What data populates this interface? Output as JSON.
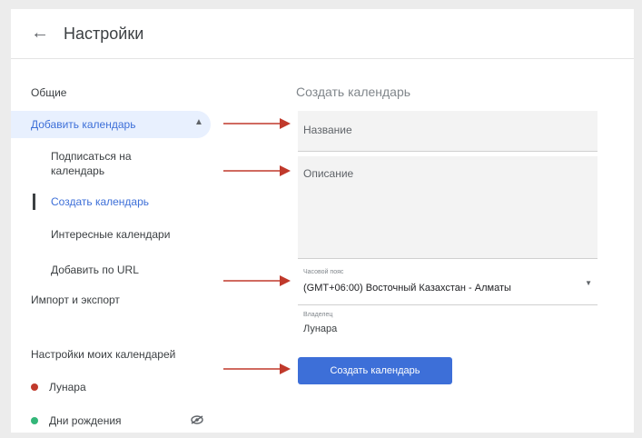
{
  "header": {
    "title": "Настройки",
    "back_icon": "arrow-left-icon"
  },
  "sidebar": {
    "general": "Общие",
    "add_calendar": "Добавить календарь",
    "sub_items": {
      "subscribe_line1": "Подписаться на",
      "subscribe_line2": "календарь",
      "create": "Создать календарь",
      "browse": "Интересные календари",
      "from_url": "Добавить по URL"
    },
    "import_export": "Импорт и экспорт",
    "my_calendars_heading": "Настройки моих календарей",
    "calendars": [
      {
        "name": "Лунара",
        "color": "#c0392b"
      },
      {
        "name": "Дни рождения",
        "color": "#33b679"
      }
    ]
  },
  "form": {
    "heading": "Создать календарь",
    "name_label": "Название",
    "description_label": "Описание",
    "timezone_label": "Часовой пояс",
    "timezone_value": "(GMT+06:00) Восточный Казахстан - Алматы",
    "owner_label": "Владелец",
    "owner_value": "Лунара",
    "submit_label": "Создать календарь"
  },
  "colors": {
    "accent": "#3d6fd8",
    "arrow": "#c0392b"
  }
}
